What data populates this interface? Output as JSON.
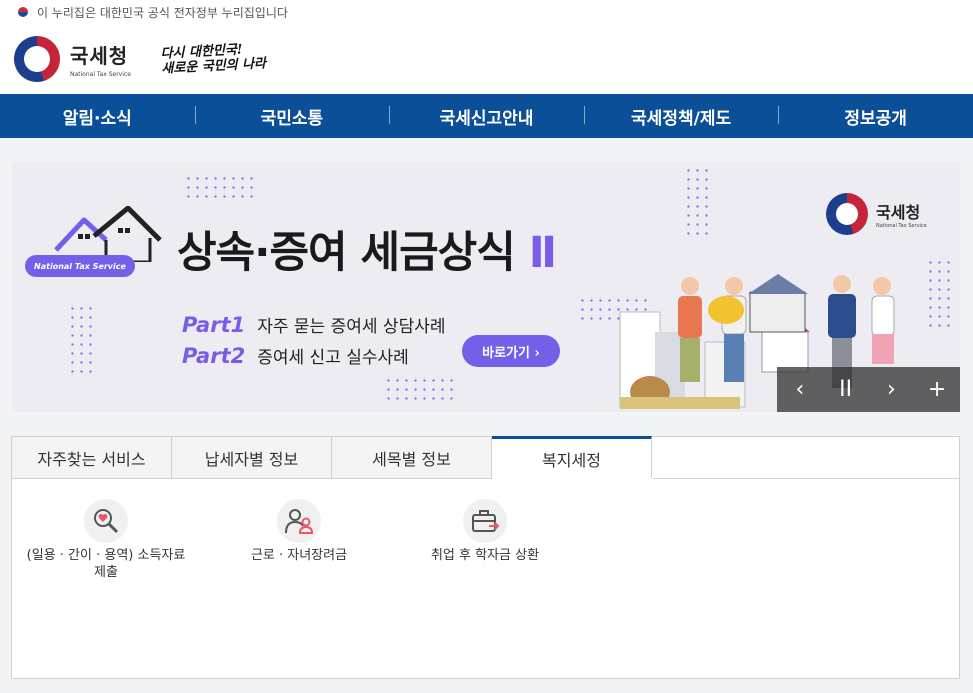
{
  "topbar": {
    "notice": "이 누리집은 대한민국 공식 전자정부 누리집입니다"
  },
  "header": {
    "logo_ko": "국세청",
    "logo_en": "National Tax Service",
    "slogan_line1": "다시 대한민국!",
    "slogan_line2": "새로운 국민의 나라"
  },
  "gnb": [
    {
      "label": "알림·소식"
    },
    {
      "label": "국민소통"
    },
    {
      "label": "국세신고안내"
    },
    {
      "label": "국세정책/제도"
    },
    {
      "label": "정보공개"
    }
  ],
  "banner": {
    "pill": "National Tax Service",
    "title_main": "상속·증여 세금상식",
    "title_roman": "Ⅱ",
    "part1_label": "Part1",
    "part1_text": "자주 묻는 증여세 상담사례",
    "part2_label": "Part2",
    "part2_text": "증여세 신고 실수사례",
    "go_button": "바로가기 ›",
    "logo_ko": "국세청",
    "logo_en": "National Tax Service",
    "accent_color": "#7360e8"
  },
  "slider_controls": {
    "prev": "‹",
    "pause": "II",
    "next": "›",
    "more": "+"
  },
  "tabs": [
    {
      "label": "자주찾는 서비스"
    },
    {
      "label": "납세자별 정보"
    },
    {
      "label": "세목별 정보"
    },
    {
      "label": "복지세정"
    }
  ],
  "services": [
    {
      "label_line1": "(일용 · 간이 · 용역) 소득자료",
      "label_line2": "제출",
      "icon": "magnifier-heart-icon"
    },
    {
      "label_line1": "근로 · 자녀장려금",
      "label_line2": "",
      "icon": "people-icon"
    },
    {
      "label_line1": "취업 후 학자금 상환",
      "label_line2": "",
      "icon": "briefcase-icon"
    }
  ],
  "colors": {
    "gnb_bg": "#0a4f98",
    "brand_red": "#c5253a",
    "brand_blue": "#1b3f8d"
  }
}
